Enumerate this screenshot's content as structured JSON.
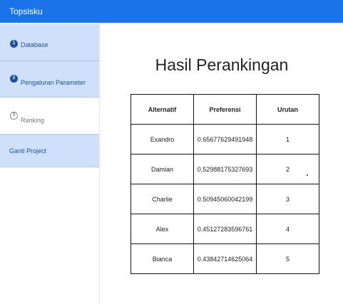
{
  "app": {
    "title": "Topsisku"
  },
  "sidebar": {
    "items": [
      {
        "label": "Database",
        "step": "1"
      },
      {
        "label": "Pengaturan Parameter",
        "step": "2"
      },
      {
        "label": "Ranking",
        "step": "3"
      },
      {
        "label": "Ganti Project"
      }
    ]
  },
  "main": {
    "title": "Hasil Perankingan",
    "table": {
      "headers": [
        "Alternatif",
        "Preferensi",
        "Urutan"
      ],
      "rows": [
        [
          "Exandro",
          "0.65677629491948",
          "1"
        ],
        [
          "Damian",
          "0.52988175327693",
          "2"
        ],
        [
          "Charlie",
          "0.50945060042199",
          "3"
        ],
        [
          "Alex",
          "0.45127283596761",
          "4"
        ],
        [
          "Bianca",
          "0.43842714625064",
          "5"
        ]
      ]
    }
  },
  "colors": {
    "topbar": "#1a73e8",
    "sidebar_inactive": "#cfe0fb",
    "sidebar_text": "#1e4f9c"
  }
}
